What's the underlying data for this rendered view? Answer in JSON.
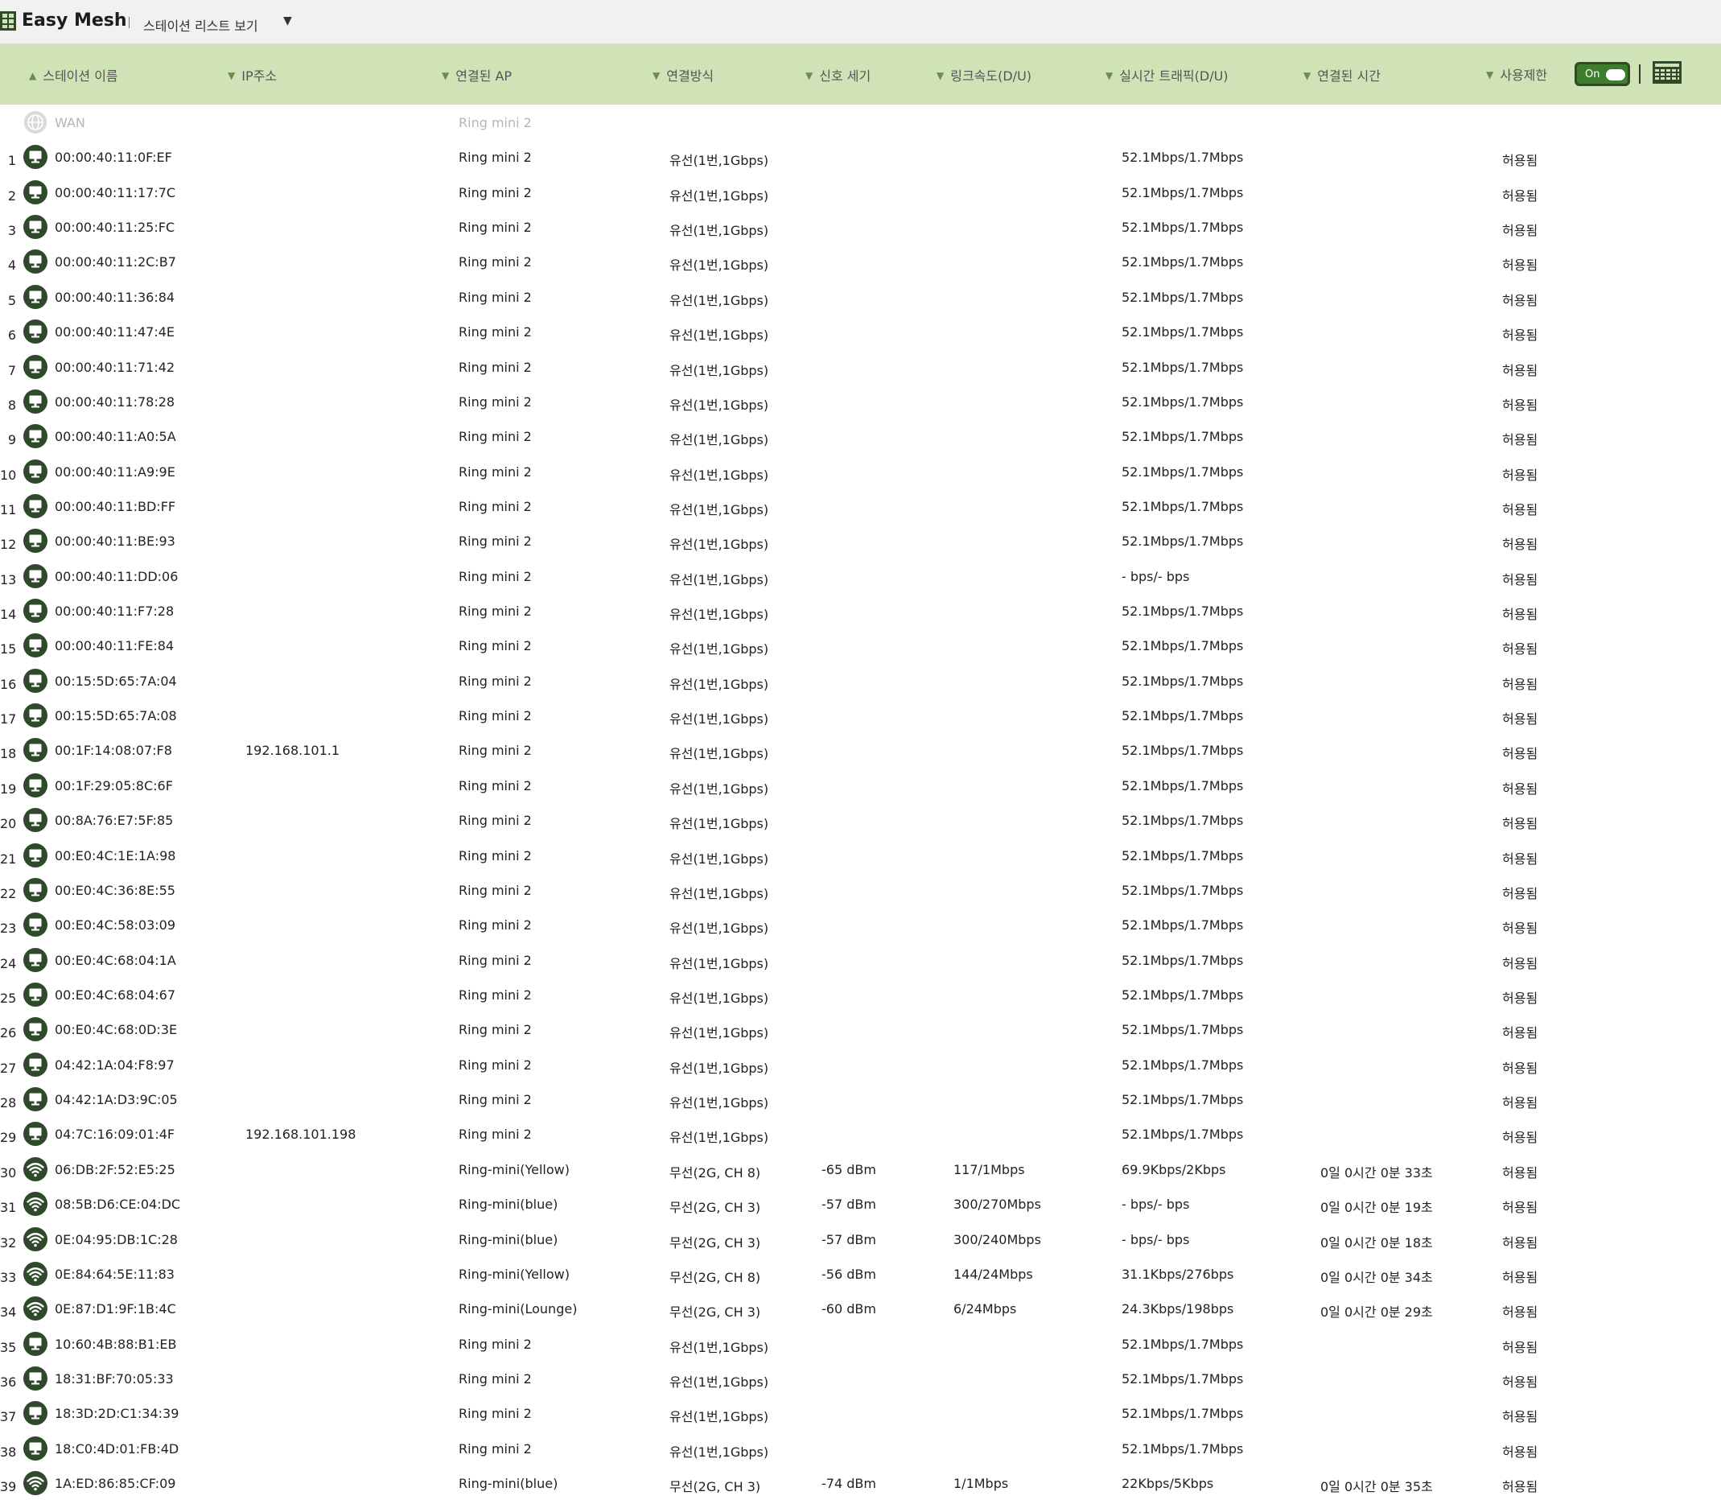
{
  "app": {
    "title": "Easy Mesh",
    "view_label": "스테이션 리스트 보기",
    "view_caret": "▼"
  },
  "header": {
    "columns": [
      {
        "label": "스테이션 이름",
        "arrow": "▲"
      },
      {
        "label": "IP주소",
        "arrow": "▼"
      },
      {
        "label": "연결된 AP",
        "arrow": "▼"
      },
      {
        "label": "연결방식",
        "arrow": "▼"
      },
      {
        "label": "신호 세기",
        "arrow": "▼"
      },
      {
        "label": "링크속도(D/U)",
        "arrow": "▼"
      },
      {
        "label": "실시간 트래픽(D/U)",
        "arrow": "▼"
      },
      {
        "label": "연결된 시간",
        "arrow": "▼"
      },
      {
        "label": "사용제한",
        "arrow": "▼"
      }
    ],
    "toggle_label": "On"
  },
  "colors": {
    "header_bg": "#cfe3b6",
    "icon_dark": "#2f4a2a",
    "toggle_on": "#3e7c2e"
  },
  "wan": {
    "name": "WAN",
    "ap": "Ring mini 2",
    "icon": "globe-icon"
  },
  "stations": [
    {
      "num": "1",
      "name": "00:00:40:11:0F:EF",
      "ip": "",
      "ap": "Ring mini 2",
      "conn": "유선(1번,1Gbps)",
      "signal": "",
      "link": "",
      "traffic": "52.1Mbps/1.7Mbps",
      "time": "",
      "limit": "허용됨",
      "icon": "monitor-icon"
    },
    {
      "num": "2",
      "name": "00:00:40:11:17:7C",
      "ip": "",
      "ap": "Ring mini 2",
      "conn": "유선(1번,1Gbps)",
      "signal": "",
      "link": "",
      "traffic": "52.1Mbps/1.7Mbps",
      "time": "",
      "limit": "허용됨",
      "icon": "monitor-icon"
    },
    {
      "num": "3",
      "name": "00:00:40:11:25:FC",
      "ip": "",
      "ap": "Ring mini 2",
      "conn": "유선(1번,1Gbps)",
      "signal": "",
      "link": "",
      "traffic": "52.1Mbps/1.7Mbps",
      "time": "",
      "limit": "허용됨",
      "icon": "monitor-icon"
    },
    {
      "num": "4",
      "name": "00:00:40:11:2C:B7",
      "ip": "",
      "ap": "Ring mini 2",
      "conn": "유선(1번,1Gbps)",
      "signal": "",
      "link": "",
      "traffic": "52.1Mbps/1.7Mbps",
      "time": "",
      "limit": "허용됨",
      "icon": "monitor-icon"
    },
    {
      "num": "5",
      "name": "00:00:40:11:36:84",
      "ip": "",
      "ap": "Ring mini 2",
      "conn": "유선(1번,1Gbps)",
      "signal": "",
      "link": "",
      "traffic": "52.1Mbps/1.7Mbps",
      "time": "",
      "limit": "허용됨",
      "icon": "monitor-icon"
    },
    {
      "num": "6",
      "name": "00:00:40:11:47:4E",
      "ip": "",
      "ap": "Ring mini 2",
      "conn": "유선(1번,1Gbps)",
      "signal": "",
      "link": "",
      "traffic": "52.1Mbps/1.7Mbps",
      "time": "",
      "limit": "허용됨",
      "icon": "monitor-icon"
    },
    {
      "num": "7",
      "name": "00:00:40:11:71:42",
      "ip": "",
      "ap": "Ring mini 2",
      "conn": "유선(1번,1Gbps)",
      "signal": "",
      "link": "",
      "traffic": "52.1Mbps/1.7Mbps",
      "time": "",
      "limit": "허용됨",
      "icon": "monitor-icon"
    },
    {
      "num": "8",
      "name": "00:00:40:11:78:28",
      "ip": "",
      "ap": "Ring mini 2",
      "conn": "유선(1번,1Gbps)",
      "signal": "",
      "link": "",
      "traffic": "52.1Mbps/1.7Mbps",
      "time": "",
      "limit": "허용됨",
      "icon": "monitor-icon"
    },
    {
      "num": "9",
      "name": "00:00:40:11:A0:5A",
      "ip": "",
      "ap": "Ring mini 2",
      "conn": "유선(1번,1Gbps)",
      "signal": "",
      "link": "",
      "traffic": "52.1Mbps/1.7Mbps",
      "time": "",
      "limit": "허용됨",
      "icon": "monitor-icon"
    },
    {
      "num": "10",
      "name": "00:00:40:11:A9:9E",
      "ip": "",
      "ap": "Ring mini 2",
      "conn": "유선(1번,1Gbps)",
      "signal": "",
      "link": "",
      "traffic": "52.1Mbps/1.7Mbps",
      "time": "",
      "limit": "허용됨",
      "icon": "monitor-icon"
    },
    {
      "num": "11",
      "name": "00:00:40:11:BD:FF",
      "ip": "",
      "ap": "Ring mini 2",
      "conn": "유선(1번,1Gbps)",
      "signal": "",
      "link": "",
      "traffic": "52.1Mbps/1.7Mbps",
      "time": "",
      "limit": "허용됨",
      "icon": "monitor-icon"
    },
    {
      "num": "12",
      "name": "00:00:40:11:BE:93",
      "ip": "",
      "ap": "Ring mini 2",
      "conn": "유선(1번,1Gbps)",
      "signal": "",
      "link": "",
      "traffic": "52.1Mbps/1.7Mbps",
      "time": "",
      "limit": "허용됨",
      "icon": "monitor-icon"
    },
    {
      "num": "13",
      "name": "00:00:40:11:DD:06",
      "ip": "",
      "ap": "Ring mini 2",
      "conn": "유선(1번,1Gbps)",
      "signal": "",
      "link": "",
      "traffic": "- bps/- bps",
      "time": "",
      "limit": "허용됨",
      "icon": "monitor-icon"
    },
    {
      "num": "14",
      "name": "00:00:40:11:F7:28",
      "ip": "",
      "ap": "Ring mini 2",
      "conn": "유선(1번,1Gbps)",
      "signal": "",
      "link": "",
      "traffic": "52.1Mbps/1.7Mbps",
      "time": "",
      "limit": "허용됨",
      "icon": "monitor-icon"
    },
    {
      "num": "15",
      "name": "00:00:40:11:FE:84",
      "ip": "",
      "ap": "Ring mini 2",
      "conn": "유선(1번,1Gbps)",
      "signal": "",
      "link": "",
      "traffic": "52.1Mbps/1.7Mbps",
      "time": "",
      "limit": "허용됨",
      "icon": "monitor-icon"
    },
    {
      "num": "16",
      "name": "00:15:5D:65:7A:04",
      "ip": "",
      "ap": "Ring mini 2",
      "conn": "유선(1번,1Gbps)",
      "signal": "",
      "link": "",
      "traffic": "52.1Mbps/1.7Mbps",
      "time": "",
      "limit": "허용됨",
      "icon": "monitor-icon"
    },
    {
      "num": "17",
      "name": "00:15:5D:65:7A:08",
      "ip": "",
      "ap": "Ring mini 2",
      "conn": "유선(1번,1Gbps)",
      "signal": "",
      "link": "",
      "traffic": "52.1Mbps/1.7Mbps",
      "time": "",
      "limit": "허용됨",
      "icon": "monitor-icon"
    },
    {
      "num": "18",
      "name": "00:1F:14:08:07:F8",
      "ip": "192.168.101.1",
      "ap": "Ring mini 2",
      "conn": "유선(1번,1Gbps)",
      "signal": "",
      "link": "",
      "traffic": "52.1Mbps/1.7Mbps",
      "time": "",
      "limit": "허용됨",
      "icon": "monitor-icon"
    },
    {
      "num": "19",
      "name": "00:1F:29:05:8C:6F",
      "ip": "",
      "ap": "Ring mini 2",
      "conn": "유선(1번,1Gbps)",
      "signal": "",
      "link": "",
      "traffic": "52.1Mbps/1.7Mbps",
      "time": "",
      "limit": "허용됨",
      "icon": "monitor-icon"
    },
    {
      "num": "20",
      "name": "00:8A:76:E7:5F:85",
      "ip": "",
      "ap": "Ring mini 2",
      "conn": "유선(1번,1Gbps)",
      "signal": "",
      "link": "",
      "traffic": "52.1Mbps/1.7Mbps",
      "time": "",
      "limit": "허용됨",
      "icon": "monitor-icon"
    },
    {
      "num": "21",
      "name": "00:E0:4C:1E:1A:98",
      "ip": "",
      "ap": "Ring mini 2",
      "conn": "유선(1번,1Gbps)",
      "signal": "",
      "link": "",
      "traffic": "52.1Mbps/1.7Mbps",
      "time": "",
      "limit": "허용됨",
      "icon": "monitor-icon"
    },
    {
      "num": "22",
      "name": "00:E0:4C:36:8E:55",
      "ip": "",
      "ap": "Ring mini 2",
      "conn": "유선(1번,1Gbps)",
      "signal": "",
      "link": "",
      "traffic": "52.1Mbps/1.7Mbps",
      "time": "",
      "limit": "허용됨",
      "icon": "monitor-icon"
    },
    {
      "num": "23",
      "name": "00:E0:4C:58:03:09",
      "ip": "",
      "ap": "Ring mini 2",
      "conn": "유선(1번,1Gbps)",
      "signal": "",
      "link": "",
      "traffic": "52.1Mbps/1.7Mbps",
      "time": "",
      "limit": "허용됨",
      "icon": "monitor-icon"
    },
    {
      "num": "24",
      "name": "00:E0:4C:68:04:1A",
      "ip": "",
      "ap": "Ring mini 2",
      "conn": "유선(1번,1Gbps)",
      "signal": "",
      "link": "",
      "traffic": "52.1Mbps/1.7Mbps",
      "time": "",
      "limit": "허용됨",
      "icon": "monitor-icon"
    },
    {
      "num": "25",
      "name": "00:E0:4C:68:04:67",
      "ip": "",
      "ap": "Ring mini 2",
      "conn": "유선(1번,1Gbps)",
      "signal": "",
      "link": "",
      "traffic": "52.1Mbps/1.7Mbps",
      "time": "",
      "limit": "허용됨",
      "icon": "monitor-icon"
    },
    {
      "num": "26",
      "name": "00:E0:4C:68:0D:3E",
      "ip": "",
      "ap": "Ring mini 2",
      "conn": "유선(1번,1Gbps)",
      "signal": "",
      "link": "",
      "traffic": "52.1Mbps/1.7Mbps",
      "time": "",
      "limit": "허용됨",
      "icon": "monitor-icon"
    },
    {
      "num": "27",
      "name": "04:42:1A:04:F8:97",
      "ip": "",
      "ap": "Ring mini 2",
      "conn": "유선(1번,1Gbps)",
      "signal": "",
      "link": "",
      "traffic": "52.1Mbps/1.7Mbps",
      "time": "",
      "limit": "허용됨",
      "icon": "monitor-icon"
    },
    {
      "num": "28",
      "name": "04:42:1A:D3:9C:05",
      "ip": "",
      "ap": "Ring mini 2",
      "conn": "유선(1번,1Gbps)",
      "signal": "",
      "link": "",
      "traffic": "52.1Mbps/1.7Mbps",
      "time": "",
      "limit": "허용됨",
      "icon": "monitor-icon"
    },
    {
      "num": "29",
      "name": "04:7C:16:09:01:4F",
      "ip": "192.168.101.198",
      "ap": "Ring mini 2",
      "conn": "유선(1번,1Gbps)",
      "signal": "",
      "link": "",
      "traffic": "52.1Mbps/1.7Mbps",
      "time": "",
      "limit": "허용됨",
      "icon": "monitor-icon"
    },
    {
      "num": "30",
      "name": "06:DB:2F:52:E5:25",
      "ip": "",
      "ap": "Ring-mini(Yellow)",
      "conn": "무선(2G, CH 8)",
      "signal": "-65 dBm",
      "link": "117/1Mbps",
      "traffic": "69.9Kbps/2Kbps",
      "time": "0일 0시간 0분 33초",
      "limit": "허용됨",
      "icon": "wifi-icon"
    },
    {
      "num": "31",
      "name": "08:5B:D6:CE:04:DC",
      "ip": "",
      "ap": "Ring-mini(blue)",
      "conn": "무선(2G, CH 3)",
      "signal": "-57 dBm",
      "link": "300/270Mbps",
      "traffic": "- bps/- bps",
      "time": "0일 0시간 0분 19초",
      "limit": "허용됨",
      "icon": "wifi-icon"
    },
    {
      "num": "32",
      "name": "0E:04:95:DB:1C:28",
      "ip": "",
      "ap": "Ring-mini(blue)",
      "conn": "무선(2G, CH 3)",
      "signal": "-57 dBm",
      "link": "300/240Mbps",
      "traffic": "- bps/- bps",
      "time": "0일 0시간 0분 18초",
      "limit": "허용됨",
      "icon": "wifi-icon"
    },
    {
      "num": "33",
      "name": "0E:84:64:5E:11:83",
      "ip": "",
      "ap": "Ring-mini(Yellow)",
      "conn": "무선(2G, CH 8)",
      "signal": "-56 dBm",
      "link": "144/24Mbps",
      "traffic": "31.1Kbps/276bps",
      "time": "0일 0시간 0분 34초",
      "limit": "허용됨",
      "icon": "wifi-icon"
    },
    {
      "num": "34",
      "name": "0E:87:D1:9F:1B:4C",
      "ip": "",
      "ap": "Ring-mini(Lounge)",
      "conn": "무선(2G, CH 3)",
      "signal": "-60 dBm",
      "link": "6/24Mbps",
      "traffic": "24.3Kbps/198bps",
      "time": "0일 0시간 0분 29초",
      "limit": "허용됨",
      "icon": "wifi-icon"
    },
    {
      "num": "35",
      "name": "10:60:4B:88:B1:EB",
      "ip": "",
      "ap": "Ring mini 2",
      "conn": "유선(1번,1Gbps)",
      "signal": "",
      "link": "",
      "traffic": "52.1Mbps/1.7Mbps",
      "time": "",
      "limit": "허용됨",
      "icon": "monitor-icon"
    },
    {
      "num": "36",
      "name": "18:31:BF:70:05:33",
      "ip": "",
      "ap": "Ring mini 2",
      "conn": "유선(1번,1Gbps)",
      "signal": "",
      "link": "",
      "traffic": "52.1Mbps/1.7Mbps",
      "time": "",
      "limit": "허용됨",
      "icon": "monitor-icon"
    },
    {
      "num": "37",
      "name": "18:3D:2D:C1:34:39",
      "ip": "",
      "ap": "Ring mini 2",
      "conn": "유선(1번,1Gbps)",
      "signal": "",
      "link": "",
      "traffic": "52.1Mbps/1.7Mbps",
      "time": "",
      "limit": "허용됨",
      "icon": "monitor-icon"
    },
    {
      "num": "38",
      "name": "18:C0:4D:01:FB:4D",
      "ip": "",
      "ap": "Ring mini 2",
      "conn": "유선(1번,1Gbps)",
      "signal": "",
      "link": "",
      "traffic": "52.1Mbps/1.7Mbps",
      "time": "",
      "limit": "허용됨",
      "icon": "monitor-icon"
    },
    {
      "num": "39",
      "name": "1A:ED:86:85:CF:09",
      "ip": "",
      "ap": "Ring-mini(blue)",
      "conn": "무선(2G, CH 3)",
      "signal": "-74 dBm",
      "link": "1/1Mbps",
      "traffic": "22Kbps/5Kbps",
      "time": "0일 0시간 0분 35초",
      "limit": "허용됨",
      "icon": "wifi-icon"
    }
  ]
}
